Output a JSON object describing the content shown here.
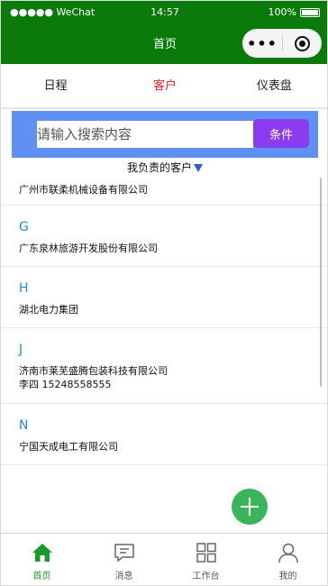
{
  "status_bar": {
    "carrier": "●●●●● WeChat",
    "time": "14:57",
    "battery": "100%"
  },
  "navbar": {
    "title": "首页"
  },
  "tabs": [
    {
      "label": "日程",
      "active": false
    },
    {
      "label": "客户",
      "active": true
    },
    {
      "label": "仪表盘",
      "active": false
    }
  ],
  "search": {
    "placeholder": "请输入搜索内容",
    "button_label": "条件"
  },
  "filter": {
    "label": "我负责的客户"
  },
  "customer_list": [
    {
      "letter": "",
      "company": "广州市联柔机械设备有限公司",
      "contact": ""
    },
    {
      "letter": "G",
      "company": "广东泉林旅游开发股份有限公司",
      "contact": ""
    },
    {
      "letter": "H",
      "company": "湖北电力集团",
      "contact": ""
    },
    {
      "letter": "J",
      "company": "济南市莱芜盛腾包装科技有限公司",
      "contact": "李四 15248558555"
    },
    {
      "letter": "N",
      "company": "宁国天成电工有限公司",
      "contact": ""
    }
  ],
  "bottom_tabbar": [
    {
      "label": "首页",
      "icon": "home-icon",
      "active": true
    },
    {
      "label": "消息",
      "icon": "message-icon",
      "active": false
    },
    {
      "label": "工作台",
      "icon": "workbench-icon",
      "active": false
    },
    {
      "label": "我的",
      "icon": "profile-icon",
      "active": false
    }
  ],
  "colors": {
    "header_bg": "#0a7a0a",
    "active_tab": "#e02020",
    "search_panel": "#5f91f2",
    "condition_button": "#8b3cf0",
    "letter_index": "#2a8ad6",
    "fab": "#3cb55a",
    "tabbar_active": "#1a9a2a"
  }
}
